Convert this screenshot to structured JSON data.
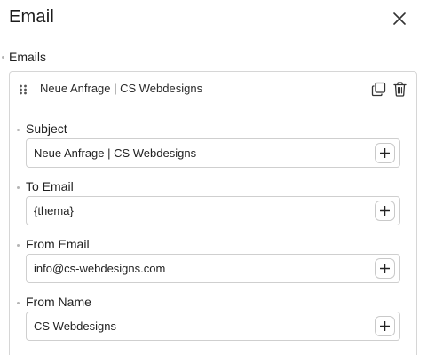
{
  "header": {
    "title": "Email"
  },
  "emails_section": {
    "label": "Emails"
  },
  "email_item": {
    "title": "Neue Anfrage | CS Webdesigns",
    "fields": [
      {
        "label": "Subject",
        "value": "Neue Anfrage | CS Webdesigns"
      },
      {
        "label": "To Email",
        "value": "{thema}"
      },
      {
        "label": "From Email",
        "value": "info@cs-webdesigns.com"
      },
      {
        "label": "From Name",
        "value": "CS Webdesigns"
      }
    ]
  },
  "icons": {
    "close": "close-icon",
    "drag": "drag-handle-icon",
    "duplicate": "duplicate-icon",
    "delete": "trash-icon",
    "insert": "plus-icon"
  },
  "colors": {
    "border": "#d6d6d6",
    "text": "#1f1f1f",
    "dot": "#b5b5b5"
  }
}
